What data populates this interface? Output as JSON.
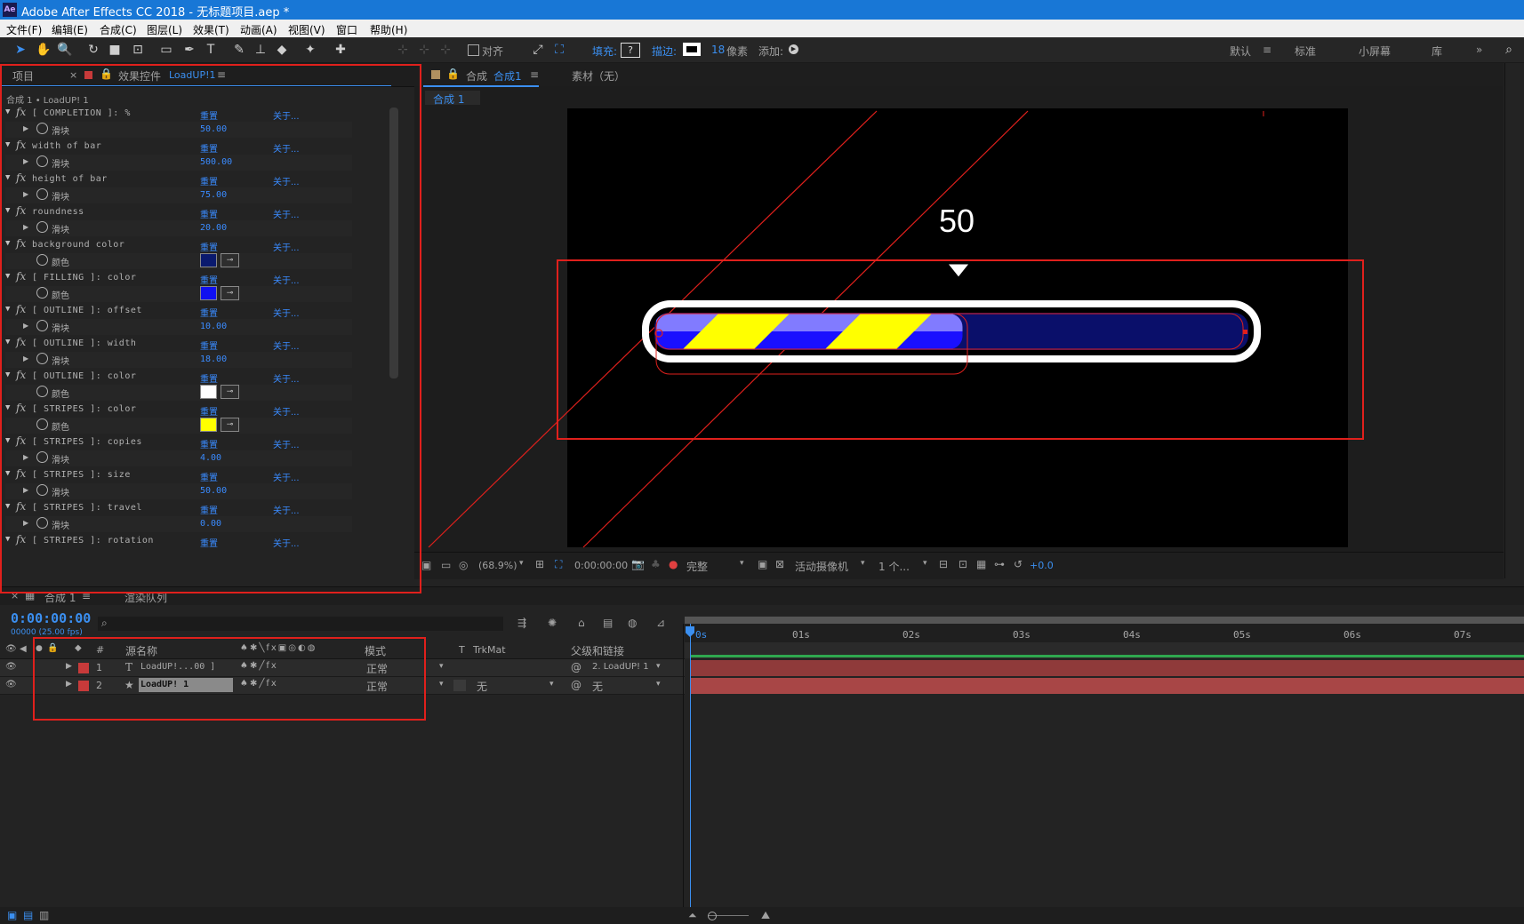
{
  "window": {
    "title": "Adobe After Effects CC 2018 - 无标题项目.aep *",
    "app_icon": "Ae"
  },
  "menu": [
    "文件(F)",
    "编辑(E)",
    "合成(C)",
    "图层(L)",
    "效果(T)",
    "动画(A)",
    "视图(V)",
    "窗口",
    "帮助(H)"
  ],
  "toolbar": {
    "align_label": "对齐",
    "fill_label": "填充:",
    "fill_value": "?",
    "stroke_label": "描边:",
    "stroke_size": "18",
    "stroke_unit": "像素",
    "add_label": "添加:",
    "workspaces": [
      "默认",
      "标准",
      "小屏幕",
      "库"
    ],
    "more": "»"
  },
  "left_panel": {
    "tab_project": "项目",
    "tab_close": "×",
    "tab_effects": "效果控件",
    "tab_effects_layer": "LoadUP!1",
    "menu_icon": "≡",
    "breadcrumb": "合成 1 • LoadUP! 1",
    "reset_label": "重置",
    "about_label": "关于...",
    "slider_label": "滑块",
    "color_label": "颜色",
    "effects": [
      {
        "name": "[ COMPLETION ]: %",
        "type": "slider",
        "value": "50.00"
      },
      {
        "name": "width of bar",
        "type": "slider",
        "value": "500.00"
      },
      {
        "name": "height of bar",
        "type": "slider",
        "value": "75.00"
      },
      {
        "name": "roundness",
        "type": "slider",
        "value": "20.00"
      },
      {
        "name": "background color",
        "type": "color",
        "color": "#0a1a6e"
      },
      {
        "name": "[ FILLING ]: color",
        "type": "color",
        "color": "#1010f0"
      },
      {
        "name": "[ OUTLINE ]: offset",
        "type": "slider",
        "value": "10.00"
      },
      {
        "name": "[ OUTLINE ]: width",
        "type": "slider",
        "value": "18.00"
      },
      {
        "name": "[ OUTLINE ]: color",
        "type": "color",
        "color": "#ffffff"
      },
      {
        "name": "[ STRIPES ]: color",
        "type": "color",
        "color": "#ffff00"
      },
      {
        "name": "[ STRIPES ]: copies",
        "type": "slider",
        "value": "4.00"
      },
      {
        "name": "[ STRIPES ]: size",
        "type": "slider",
        "value": "50.00"
      },
      {
        "name": "[ STRIPES ]: travel",
        "type": "slider",
        "value": "0.00"
      },
      {
        "name": "[ STRIPES ]: rotation",
        "type": "partial",
        "value": ""
      }
    ]
  },
  "comp_panel": {
    "tab_comp": "合成",
    "tab_comp_name": "合成1",
    "menu_icon": "≡",
    "tab_footage": "素材（无）",
    "subtab": "合成 1",
    "display_number": "50",
    "progress_fraction": 0.5,
    "colors": {
      "bg": "#000000",
      "bar_bg": "#0a0f6a",
      "fill": "#1a10ff",
      "stripe": "#ffff00",
      "outline": "#ffffff",
      "guide": "#e0201c"
    },
    "bottom": {
      "zoom": "(68.9%)",
      "timecode": "0:00:00:00",
      "resolution": "完整",
      "camera": "活动摄像机",
      "views": "1 个...",
      "exposure": "+0.0"
    }
  },
  "timeline": {
    "tab_comp": "合成 1",
    "tab_render": "渲染队列",
    "timecode": "0:00:00:00",
    "frames": "00000 (25.00 fps)",
    "search_icon": "⌕",
    "columns": {
      "num": "#",
      "source": "源名称",
      "mode": "模式",
      "t": "T",
      "trkmat": "TrkMat",
      "parent": "父级和链接"
    },
    "layers": [
      {
        "index": "1",
        "type_icon": "T",
        "name": "LoadUP!...00 ]",
        "color": "#c73a3a",
        "mode": "正常",
        "trkmat": "",
        "parent": "2. LoadUP! 1"
      },
      {
        "index": "2",
        "type_icon": "★",
        "name": "LoadUP! 1",
        "color": "#c73a3a",
        "mode": "正常",
        "trkmat": "无",
        "parent": "无"
      }
    ],
    "ruler": [
      "0s",
      "01s",
      "02s",
      "03s",
      "04s",
      "05s",
      "06s",
      "07s"
    ]
  }
}
